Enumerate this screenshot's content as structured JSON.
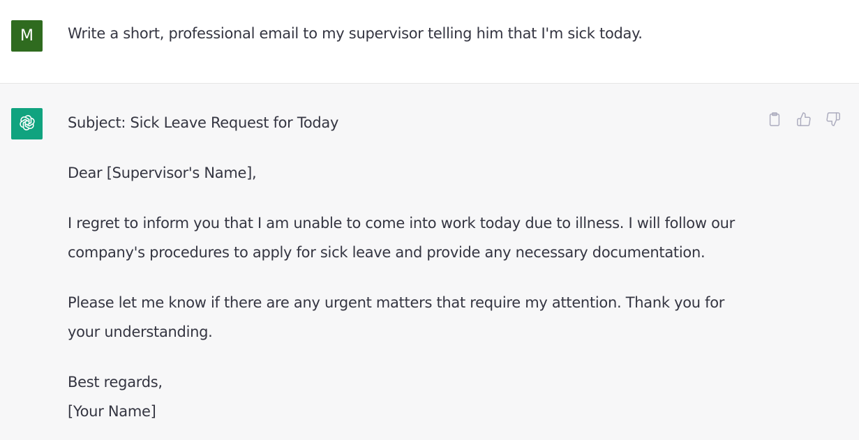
{
  "user_message": {
    "avatar_letter": "M",
    "avatar_color": "#2f6b1f",
    "text": "Write a short, professional email to my supervisor telling him that I'm sick today."
  },
  "assistant_message": {
    "avatar_color": "#10a37f",
    "avatar_icon": "openai-logo-icon",
    "subject": "Subject: Sick Leave Request for Today",
    "greeting": "Dear [Supervisor's Name],",
    "paragraph1": "I regret to inform you that I am unable to come into work today due to illness. I will follow our company's procedures to apply for sick leave and provide any necessary documentation.",
    "paragraph2": "Please let me know if there are any urgent matters that require my attention. Thank you for your understanding.",
    "closing": "Best regards,",
    "signature": "[Your Name]"
  },
  "actions": {
    "icons": [
      "clipboard-icon",
      "thumbs-up-icon",
      "thumbs-down-icon"
    ],
    "icon_color": "#acacbe"
  }
}
